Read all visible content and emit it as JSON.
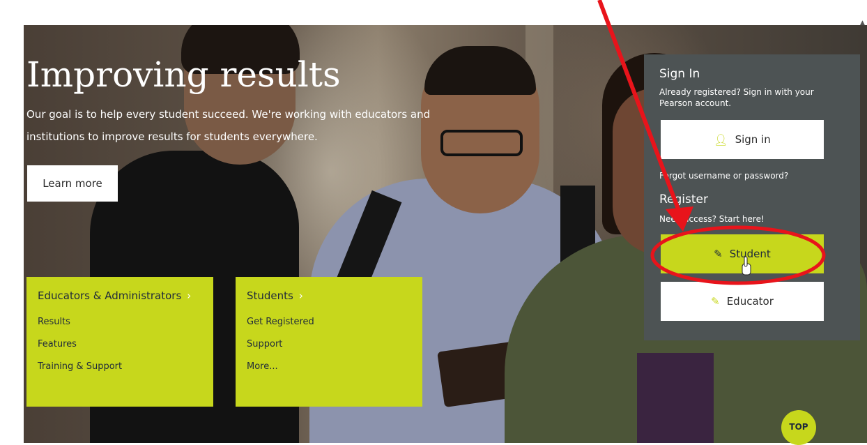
{
  "hero": {
    "headline": "Improving results",
    "subtext": "Our goal is to help every student succeed. We're working with educators and institutions to improve results for students everywhere.",
    "learn_more_label": "Learn more"
  },
  "cards": {
    "educators": {
      "title": "Educators & Administrators",
      "links": [
        "Results",
        "Features",
        "Training & Support"
      ]
    },
    "students": {
      "title": "Students",
      "links": [
        "Get Registered",
        "Support",
        "More..."
      ]
    }
  },
  "panel": {
    "signin_title": "Sign In",
    "signin_text": "Already registered? Sign in with your Pearson account.",
    "signin_button": "Sign in",
    "forgot_link": "Forgot username or password?",
    "register_title": "Register",
    "register_text": "Need access? Start here!",
    "student_button": "Student",
    "educator_button": "Educator"
  },
  "top_button_label": "TOP",
  "colors": {
    "accent": "#c7d71c",
    "panel_bg": "#4d5354",
    "annotation": "#e8141b"
  },
  "icons": {
    "signin": "user-icon",
    "student": "pencil-icon",
    "educator": "pencil-icon"
  }
}
